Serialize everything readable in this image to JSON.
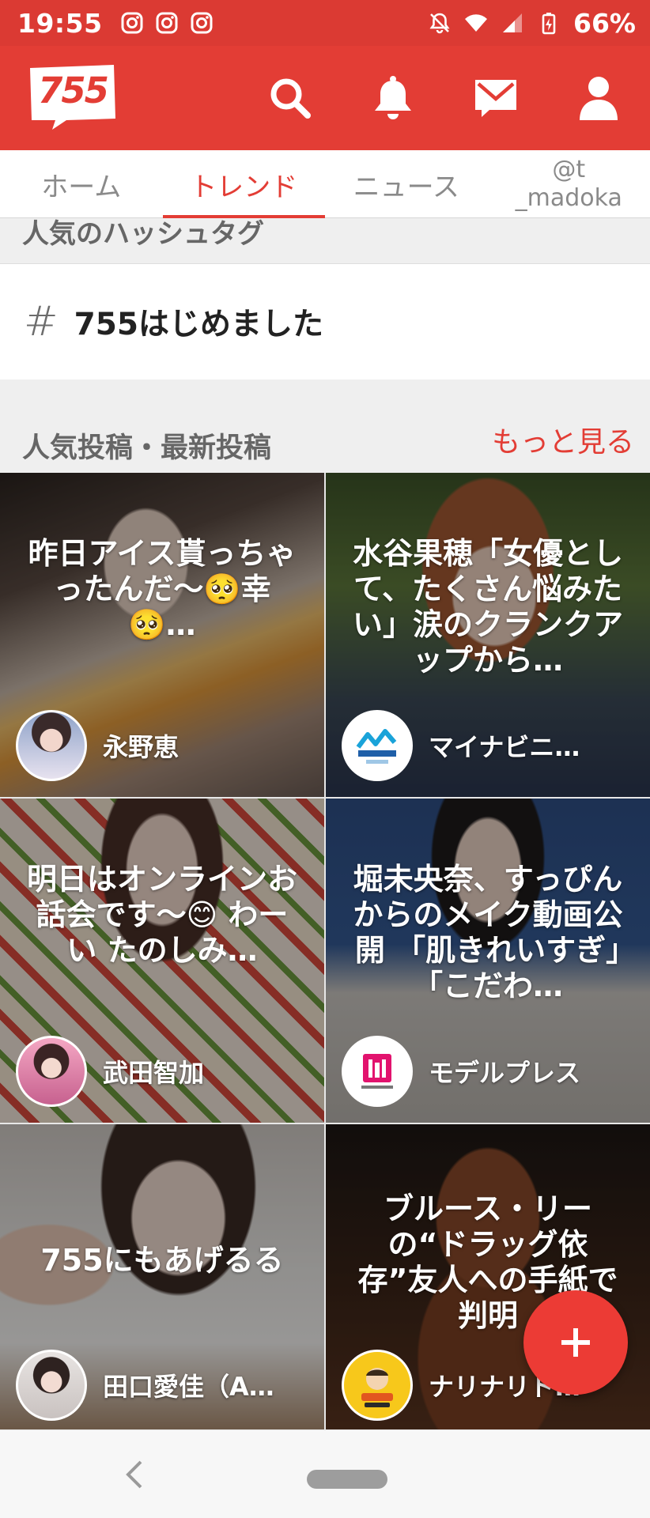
{
  "status_bar": {
    "time": "19:55",
    "battery": "66%",
    "left_icons": [
      "instagram-icon",
      "instagram-icon",
      "instagram-icon"
    ],
    "right_icons": [
      "bell-off-icon",
      "wifi-icon",
      "cellular-signal-icon",
      "battery-charging-icon"
    ]
  },
  "header": {
    "logo_text": "755",
    "icons": [
      "search-icon",
      "bell-icon",
      "mail-icon",
      "user-icon"
    ],
    "brand_color": "#e33d35"
  },
  "tabs": [
    {
      "label": "ホーム",
      "active": false
    },
    {
      "label": "トレンド",
      "active": true
    },
    {
      "label": "ニュース",
      "active": false
    },
    {
      "label_line1": "@t",
      "label_line2": "_madoka",
      "active": false
    }
  ],
  "hashtag_section": {
    "title": "人気のハッシュタグ",
    "symbol": "#",
    "tag": "755はじめました"
  },
  "posts_section": {
    "title": "人気投稿・最新投稿",
    "more": "もっと見る",
    "posts": [
      {
        "title": "昨日アイス貰っちゃったんだ〜🥺幸🥺…",
        "author": "永野恵"
      },
      {
        "title": "水谷果穂「女優として、たくさん悩みたい」涙のクランクアップから…",
        "author": "マイナビニ…"
      },
      {
        "title": "明日はオンラインお話会です〜😊 わーい たのしみ…",
        "author": "武田智加"
      },
      {
        "title": "堀未央奈、すっぴんからのメイク動画公開 「肌きれいすぎ」「こだわ…",
        "author": "モデルプレス"
      },
      {
        "title": "755にもあげるる",
        "author": "田口愛佳（A…"
      },
      {
        "title": "ブルース・リーの“ドラッグ依存”友人への手紙で判明",
        "author": "ナリナリド…"
      }
    ]
  },
  "fab": {
    "icon": "plus-icon"
  },
  "nav": {
    "icons": [
      "back-chevron-icon",
      "home-pill-icon"
    ]
  }
}
